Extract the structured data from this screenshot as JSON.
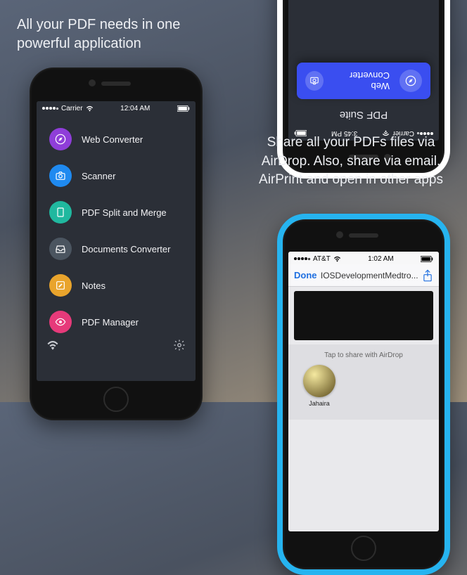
{
  "left": {
    "headline": "All your PDF needs in one powerful application",
    "statusbar": {
      "carrier": "Carrier",
      "time": "12:04 AM"
    },
    "menu": [
      {
        "label": "Web Converter",
        "color": "c-purple",
        "icon": "compass-icon"
      },
      {
        "label": "Scanner",
        "color": "c-blue",
        "icon": "camera-icon"
      },
      {
        "label": "PDF Split and Merge",
        "color": "c-teal",
        "icon": "doc-icon"
      },
      {
        "label": "Documents Converter",
        "color": "c-gray",
        "icon": "inbox-icon"
      },
      {
        "label": "Notes",
        "color": "c-amber",
        "icon": "pencil-icon"
      },
      {
        "label": "PDF Manager",
        "color": "c-pink",
        "icon": "eye-icon"
      }
    ]
  },
  "right": {
    "headline": "Share all your PDFs files via AirDrop. Also, share via email, AirPrint and open in other apps",
    "top_phone": {
      "row_label": "Web Converter",
      "title": "PDF Suite",
      "statusbar": {
        "carrier": "Carrier",
        "time": "3:45 PM"
      }
    },
    "bottom_phone": {
      "statusbar": {
        "carrier": "AT&T",
        "time": "1:02 AM"
      },
      "navbar": {
        "done": "Done",
        "title": "IOSDevelopmentMedtro..."
      },
      "sheet_hint": "Tap to share with AirDrop",
      "contact_name": "Jahaira"
    }
  }
}
